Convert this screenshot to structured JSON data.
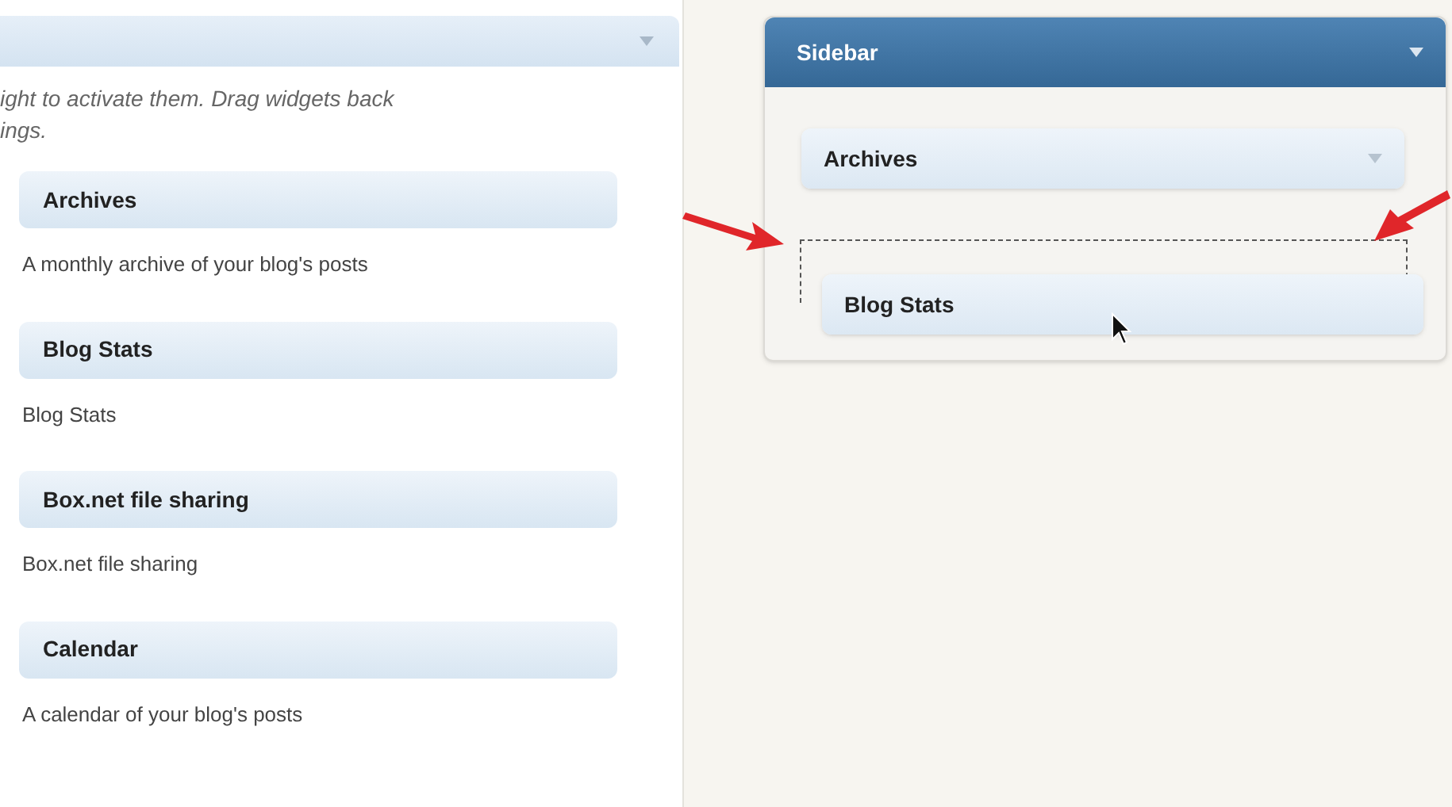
{
  "available_widgets": {
    "description_lines": [
      "ight to activate them. Drag widgets back",
      "ings."
    ],
    "widgets": [
      {
        "title": "Archives",
        "description": "A monthly archive of your blog's posts"
      },
      {
        "title": "Blog Stats",
        "description": "Blog Stats"
      },
      {
        "title": "Box.net file sharing",
        "description": "Box.net file sharing"
      },
      {
        "title": "Calendar",
        "description": "A calendar of your blog's posts"
      }
    ]
  },
  "sidebar": {
    "title": "Sidebar",
    "widgets": [
      {
        "title": "Archives"
      }
    ],
    "dragged_widget": {
      "title": "Blog Stats"
    }
  }
}
